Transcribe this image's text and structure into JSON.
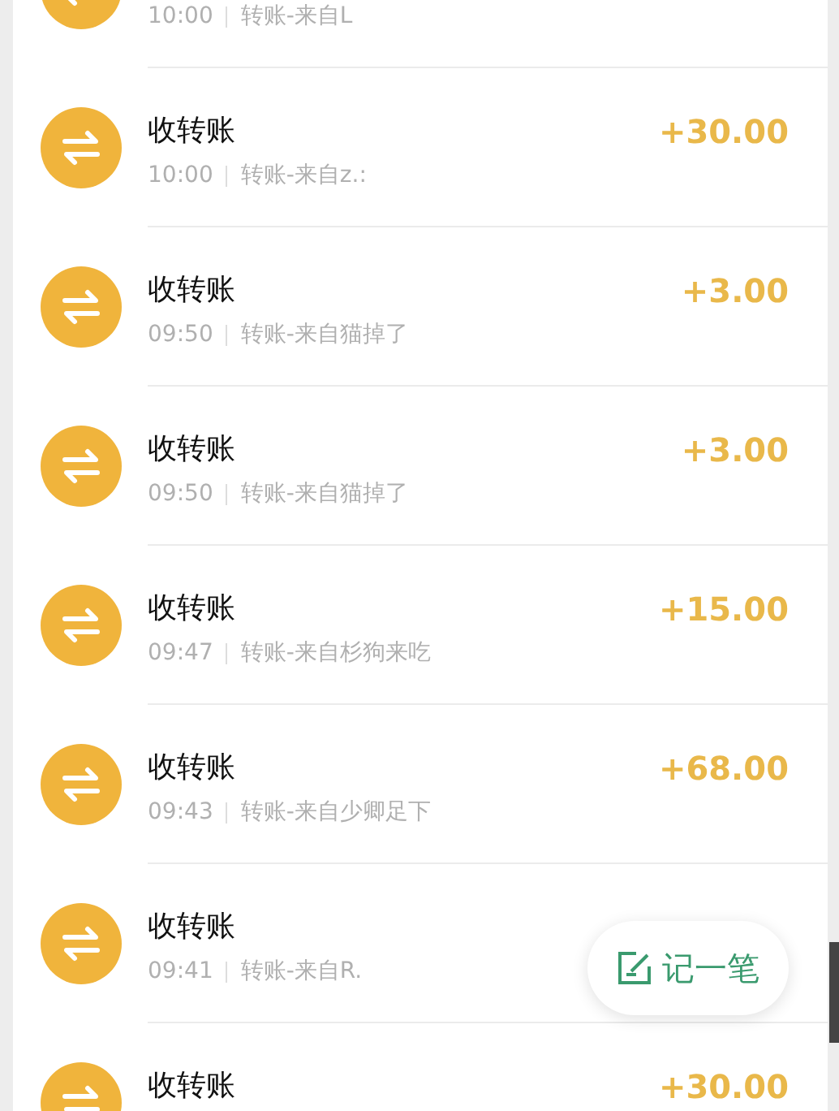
{
  "transactions": [
    {
      "time": "10:00",
      "description": "转账-来自L"
    },
    {
      "title": "收转账",
      "time": "10:00",
      "description": "转账-来自z.:",
      "amount": "+30.00"
    },
    {
      "title": "收转账",
      "time": "09:50",
      "description": "转账-来自猫掉了",
      "amount": "+3.00"
    },
    {
      "title": "收转账",
      "time": "09:50",
      "description": "转账-来自猫掉了",
      "amount": "+3.00"
    },
    {
      "title": "收转账",
      "time": "09:47",
      "description": "转账-来自杉狗来吃",
      "amount": "+15.00"
    },
    {
      "title": "收转账",
      "time": "09:43",
      "description": "转账-来自少卿足下",
      "amount": "+68.00"
    },
    {
      "title": "收转账",
      "time": "09:41",
      "description": "转账-来自R."
    },
    {
      "title": "收转账",
      "amount": "+30.00"
    }
  ],
  "fab": {
    "label": "记一笔"
  }
}
